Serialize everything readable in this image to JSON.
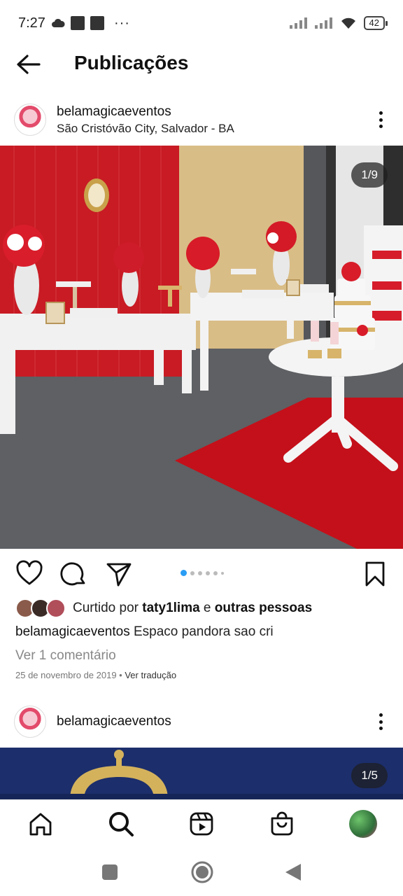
{
  "status_bar": {
    "time": "7:27",
    "more": "···",
    "battery": "42"
  },
  "header": {
    "title": "Publicações",
    "back_icon": "arrow-left-icon"
  },
  "posts": [
    {
      "username": "belamagicaeventos",
      "location": "São Cristóvão City, Salvador - BA",
      "counter": "1/9",
      "carousel_dots": 6,
      "active_dot": 1,
      "liked_by_prefix": "Curtido por ",
      "liked_by_user": "taty1lima",
      "liked_by_mid": " e ",
      "liked_by_others": "outras pessoas",
      "caption_user": "belamagicaeventos",
      "caption_text": " Espaco pandora sao cri",
      "comments_link": "Ver 1 comentário",
      "date": "25 de novembro de 2019",
      "separator": " • ",
      "translate": "Ver tradução"
    },
    {
      "username": "belamagicaeventos",
      "counter": "1/5"
    }
  ],
  "icons": {
    "like": "heart-icon",
    "comment": "comment-icon",
    "share": "send-icon",
    "save": "bookmark-icon",
    "home": "home-icon",
    "search": "search-icon",
    "reels": "reels-icon",
    "shop": "shop-bag-icon",
    "profile": "profile-avatar"
  },
  "colors": {
    "accent_dot": "#2a9df4",
    "backdrop_red": "#c81b24",
    "curtain_gold": "#d9bd86",
    "carpet_red": "#c4101a",
    "crown_gold": "#d4b25c",
    "banner_blue": "#1c2e6b"
  }
}
